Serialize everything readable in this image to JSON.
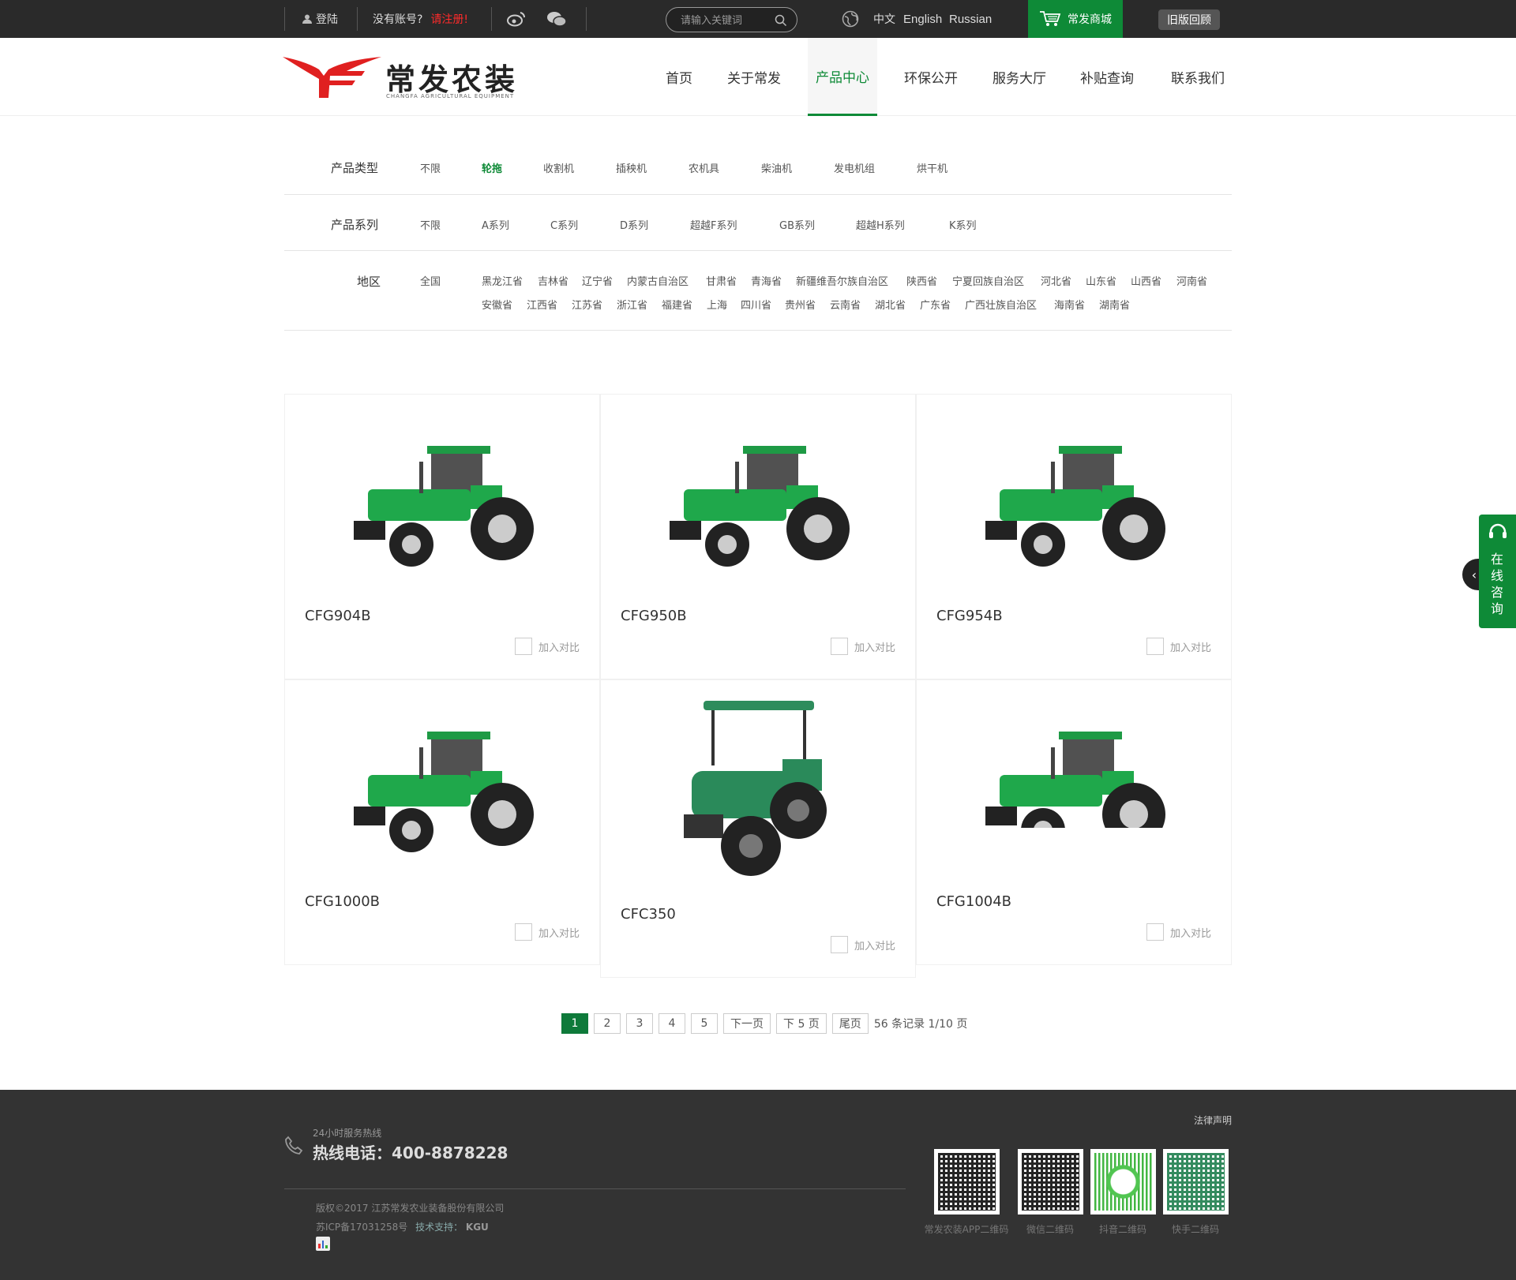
{
  "topbar": {
    "login": "登陆",
    "no_account": "没有账号?",
    "register": "请注册!",
    "search_placeholder": "请输入关键词",
    "lang_cn": "中文",
    "lang_en": "English",
    "lang_ru": "Russian",
    "shop": "常发商城",
    "old_version": "旧版回顾"
  },
  "brand": {
    "name_cn": "常发农装",
    "name_en": "CHANGFA AGRICULTURAL EQUIPMENT"
  },
  "nav": [
    "首页",
    "关于常发",
    "产品中心",
    "环保公开",
    "服务大厅",
    "补贴查询",
    "联系我们"
  ],
  "nav_active": "产品中心",
  "filters": {
    "type": {
      "label": "产品类型",
      "options": [
        "不限",
        "轮拖",
        "收割机",
        "插秧机",
        "农机具",
        "柴油机",
        "发电机组",
        "烘干机"
      ],
      "selected": "轮拖"
    },
    "series": {
      "label": "产品系列",
      "options": [
        "不限",
        "A系列",
        "C系列",
        "D系列",
        "超越F系列",
        "GB系列",
        "超越H系列",
        "K系列"
      ]
    },
    "region": {
      "label": "地区",
      "all": "全国",
      "row1": [
        "黑龙江省",
        "吉林省",
        "辽宁省",
        "内蒙古自治区",
        "甘肃省",
        "青海省",
        "新疆维吾尔族自治区",
        "陕西省",
        "宁夏回族自治区",
        "河北省",
        "山东省",
        "山西省",
        "河南省"
      ],
      "row2": [
        "安徽省",
        "江西省",
        "江苏省",
        "浙江省",
        "福建省",
        "上海",
        "四川省",
        "贵州省",
        "云南省",
        "湖北省",
        "广东省",
        "广西壮族自治区",
        "海南省",
        "湖南省"
      ]
    }
  },
  "products": [
    {
      "name": "CFG904B",
      "compare": "加入对比"
    },
    {
      "name": "CFG950B",
      "compare": "加入对比"
    },
    {
      "name": "CFG954B",
      "compare": "加入对比"
    },
    {
      "name": "CFG1000B",
      "compare": "加入对比"
    },
    {
      "name": "CFC350",
      "compare": "加入对比"
    },
    {
      "name": "CFG1004B",
      "compare": "加入对比"
    }
  ],
  "pagination": {
    "pages": [
      "1",
      "2",
      "3",
      "4",
      "5"
    ],
    "next": "下一页",
    "next5": "下 5 页",
    "last": "尾页",
    "summary": "56 条记录 1/10 页"
  },
  "side_consult": [
    "在",
    "线",
    "咨",
    "询"
  ],
  "footer": {
    "hotline_caption": "24小时服务热线",
    "hotline": "热线电话：400-8878228",
    "copyright": "版权©2017 江苏常发农业装备股份有限公司",
    "icp": "苏ICP备17031258号",
    "tech": "技术支持：",
    "tech_brand": "KGU",
    "legal": "法律声明",
    "qr": [
      "常发农装APP二维码",
      "微信二维码",
      "抖音二维码",
      "快手二维码"
    ]
  },
  "colors": {
    "accent": "#0e8a37",
    "topbar": "#2a2a2a",
    "footer": "#333333",
    "logo_red": "#e02020"
  }
}
